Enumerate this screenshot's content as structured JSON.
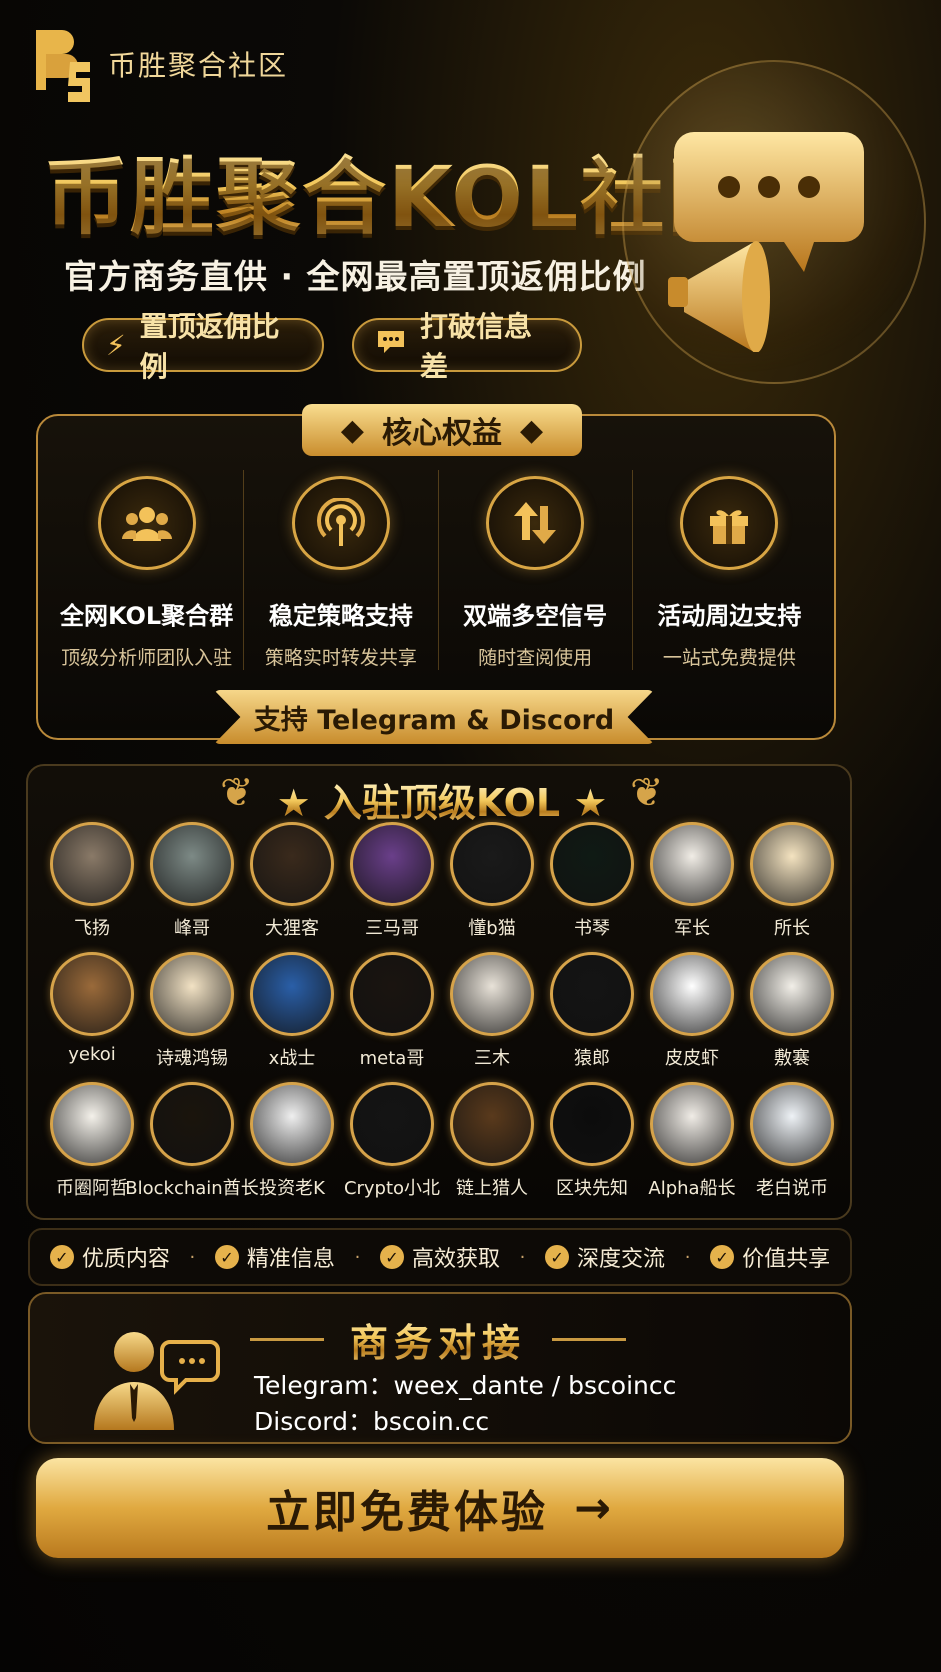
{
  "header": {
    "logo_text": "币胜聚合社区",
    "main_title": "币胜聚合KOL社区",
    "subtitle": "官方商务直供 · 全网最高置顶返佣比例",
    "pills": [
      {
        "label": "置顶返佣比例",
        "icon": "lightning-icon"
      },
      {
        "label": "打破信息差",
        "icon": "chat-icon"
      }
    ]
  },
  "core": {
    "banner": "核心权益",
    "features": [
      {
        "title": "全网KOL聚合群",
        "desc": "顶级分析师团队入驻",
        "icon": "group-icon"
      },
      {
        "title": "稳定策略支持",
        "desc": "策略实时转发共享",
        "icon": "broadcast-icon"
      },
      {
        "title": "双端多空信号",
        "desc": "随时查阅使用",
        "icon": "updown-arrows-icon"
      },
      {
        "title": "活动周边支持",
        "desc": "一站式免费提供",
        "icon": "gift-icon"
      }
    ],
    "ribbon": "支持 Telegram & Discord"
  },
  "kol": {
    "title": "入驻顶级KOL",
    "items": [
      {
        "name": "飞扬",
        "color": "#8a7a68"
      },
      {
        "name": "峰哥",
        "color": "#7d8a86"
      },
      {
        "name": "大狸客",
        "color": "#3a2a1c"
      },
      {
        "name": "三马哥",
        "color": "#6a3f8a"
      },
      {
        "name": "懂b猫",
        "color": "#1a1a1a"
      },
      {
        "name": "书琴",
        "color": "#0f1a14"
      },
      {
        "name": "军长",
        "color": "#f1ede6"
      },
      {
        "name": "所长",
        "color": "#f4e3c0"
      },
      {
        "name": "yekoi",
        "color": "#9a6a3a"
      },
      {
        "name": "诗魂鸿锡",
        "color": "#f2e2c4"
      },
      {
        "name": "x战士",
        "color": "#2a5fa8"
      },
      {
        "name": "meta哥",
        "color": "#1a1410"
      },
      {
        "name": "三木",
        "color": "#e8e2d8"
      },
      {
        "name": "猿郎",
        "color": "#141414"
      },
      {
        "name": "皮皮虾",
        "color": "#ffffff"
      },
      {
        "name": "敷褰",
        "color": "#f2efe8"
      },
      {
        "name": "币圈阿哲",
        "color": "#f4f1ea"
      },
      {
        "name": "Blockchain酋长",
        "color": "#1a140c"
      },
      {
        "name": "投资老K",
        "color": "#efefef"
      },
      {
        "name": "Crypto小北",
        "color": "#141414"
      },
      {
        "name": "链上猎人",
        "color": "#5a3a1c"
      },
      {
        "name": "区块先知",
        "color": "#0c0c0c"
      },
      {
        "name": "Alpha船长",
        "color": "#f0ece6"
      },
      {
        "name": "老白说币",
        "color": "#eef2f6"
      }
    ]
  },
  "benefits": [
    "优质内容",
    "精准信息",
    "高效获取",
    "深度交流",
    "价值共享"
  ],
  "contact": {
    "title": "商务对接",
    "telegram": "Telegram：weex_dante / bscoincc",
    "discord": "Discord：bscoin.cc"
  },
  "cta": {
    "label": "立即免费体验",
    "arrow": "→"
  },
  "colors": {
    "gold": "#e5b24c",
    "background": "#050403",
    "accent_dark": "#2a1904"
  }
}
